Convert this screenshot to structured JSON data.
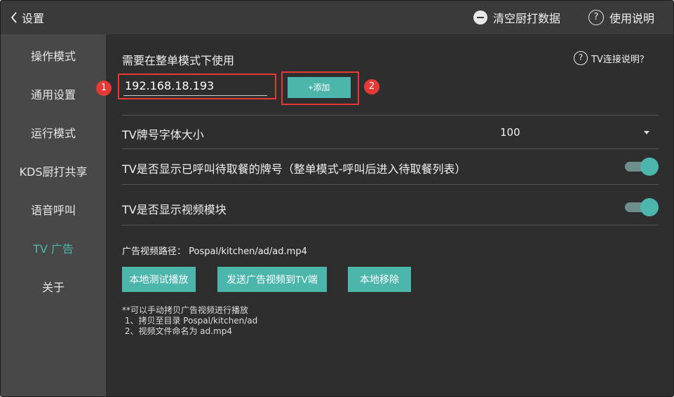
{
  "header": {
    "back_label": "设置",
    "clear_label": "清空厨打数据",
    "help_label": "使用说明",
    "help_glyph": "?"
  },
  "sidebar": {
    "items": [
      {
        "label": "操作模式",
        "active": false
      },
      {
        "label": "通用设置",
        "active": false
      },
      {
        "label": "运行模式",
        "active": false
      },
      {
        "label": "KDS厨打共享",
        "active": false
      },
      {
        "label": "语音呼叫",
        "active": false
      },
      {
        "label": "TV 广告",
        "active": true
      },
      {
        "label": "关于",
        "active": false
      }
    ]
  },
  "main": {
    "heading": "需要在整单模式下使用",
    "tv_help_label": "TV连接说明？",
    "tv_help_glyph": "?",
    "ip_value": "192.168.18.193",
    "badge_1": "1",
    "add_label": "+添加",
    "badge_2": "2",
    "font_size_label": "TV牌号字体大小",
    "font_size_value": "100",
    "show_called_label": "TV是否显示已呼叫待取餐的牌号（整单模式-呼叫后进入待取餐列表）",
    "show_called_on": true,
    "show_video_label": "TV是否显示视频模块",
    "show_video_on": true,
    "video_path_label": "广告视频路径：",
    "video_path_value": "Pospal/kitchen/ad/ad.mp4",
    "buttons": {
      "local_play": "本地测试播放",
      "send_to_tv": "发送广告视频到TV端",
      "local_remove": "本地移除"
    },
    "notes": [
      "**可以手动拷贝广告视频进行播放",
      " 1、拷贝至目录 Pospal/kitchen/ad",
      " 2、视频文件命名为 ad.mp4"
    ]
  },
  "colors": {
    "accent": "#4db6ac",
    "highlight_red": "#e53935",
    "background": "#2e2e2e",
    "sidebar": "#484848",
    "topbar": "#3a3a3a"
  }
}
